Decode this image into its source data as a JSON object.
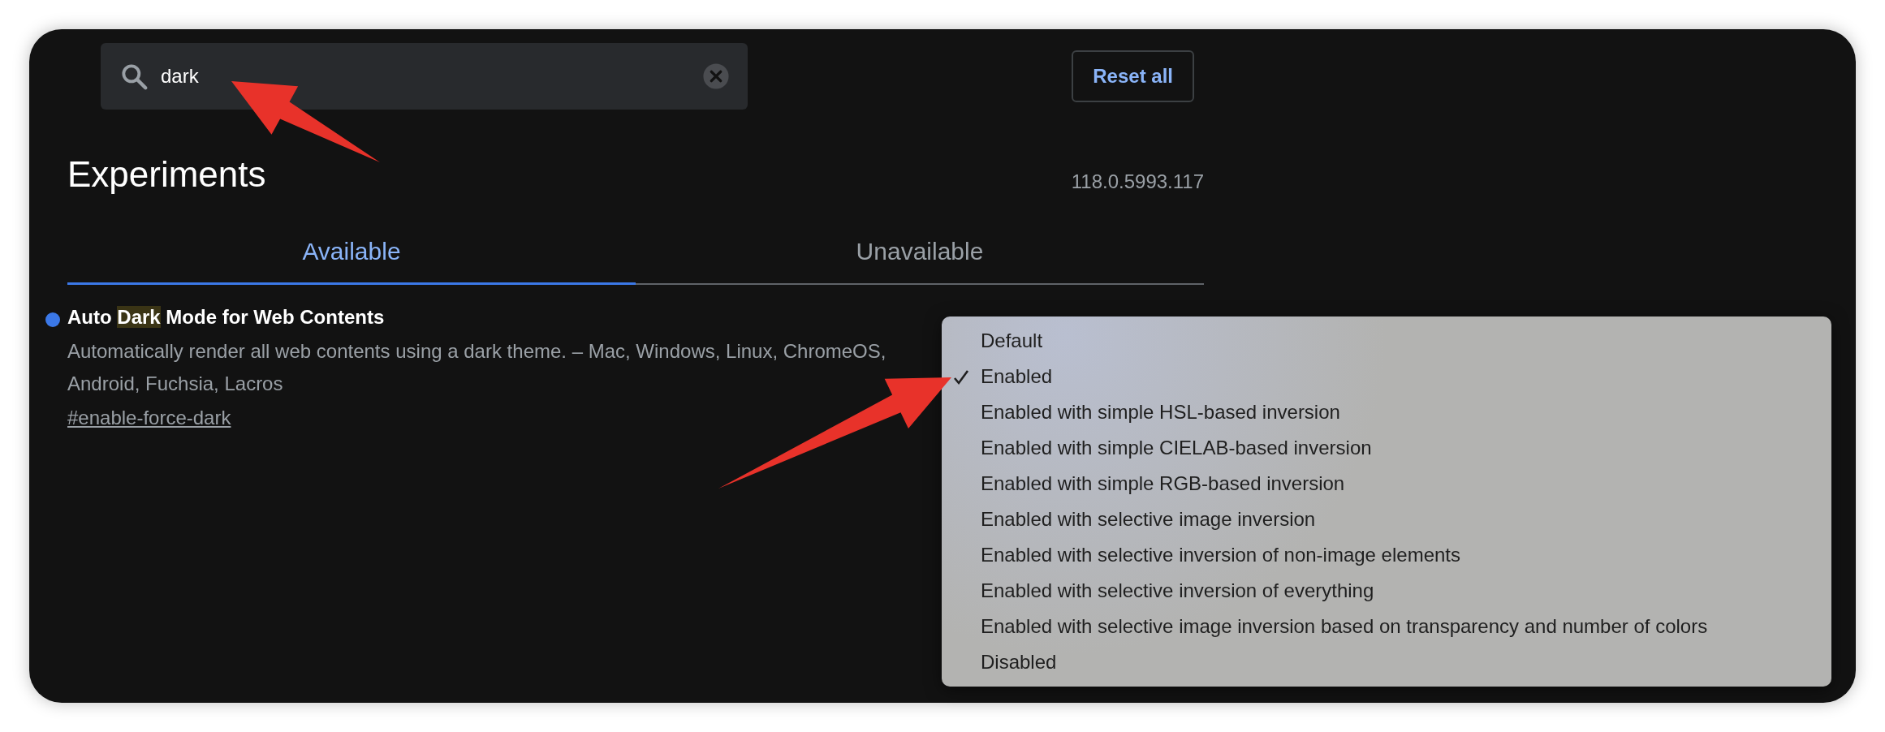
{
  "search": {
    "value": "dark"
  },
  "reset_button": "Reset all",
  "title": "Experiments",
  "version": "118.0.5993.117",
  "tabs": [
    {
      "label": "Available",
      "selected": true
    },
    {
      "label": "Unavailable",
      "selected": false
    }
  ],
  "experiments": [
    {
      "title_parts": [
        {
          "text": "Auto ",
          "highlight": false
        },
        {
          "text": "Dark",
          "highlight": true
        },
        {
          "text": " Mode for Web Contents",
          "highlight": false
        }
      ],
      "description": "Automatically render all web contents using a dark theme. – Mac, Windows, Linux, ChromeOS, Android, Fuchsia, Lacros",
      "link": "#enable-force-dark",
      "color": "#3b78e7"
    }
  ],
  "dropdown_options": [
    {
      "label": "Default",
      "selected": false
    },
    {
      "label": "Enabled",
      "selected": true
    },
    {
      "label": "Enabled with simple HSL-based inversion",
      "selected": false
    },
    {
      "label": "Enabled with simple CIELAB-based inversion",
      "selected": false
    },
    {
      "label": "Enabled with simple RGB-based inversion",
      "selected": false
    },
    {
      "label": "Enabled with selective image inversion",
      "selected": false
    },
    {
      "label": "Enabled with selective inversion of non-image elements",
      "selected": false
    },
    {
      "label": "Enabled with selective inversion of everything",
      "selected": false
    },
    {
      "label": "Enabled with selective image inversion based on transparency and number of colors",
      "selected": false
    },
    {
      "label": "Disabled",
      "selected": false
    }
  ]
}
